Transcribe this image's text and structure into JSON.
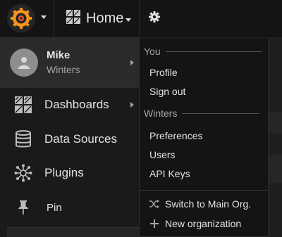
{
  "topbar": {
    "logo_icon": "grafana-logo-icon",
    "home_label": "Home",
    "gear_icon": "gear-icon"
  },
  "user": {
    "first_name": "Mike",
    "org_name": "Winters"
  },
  "nav": [
    {
      "label": "Dashboards",
      "icon": "dashboards-icon"
    },
    {
      "label": "Data Sources",
      "icon": "database-icon"
    },
    {
      "label": "Plugins",
      "icon": "plugins-icon"
    },
    {
      "label": "Pin",
      "icon": "pin-icon"
    }
  ],
  "dropdown": {
    "you_header": "You",
    "profile": "Profile",
    "sign_out": "Sign out",
    "org_header": "Winters",
    "preferences": "Preferences",
    "users": "Users",
    "api_keys": "API Keys",
    "switch_org": "Switch to Main Org.",
    "new_org": "New organization"
  },
  "colors": {
    "brand_orange": "#f7941d",
    "background": "#1f1f21",
    "active_row": "#2b2b2e"
  }
}
